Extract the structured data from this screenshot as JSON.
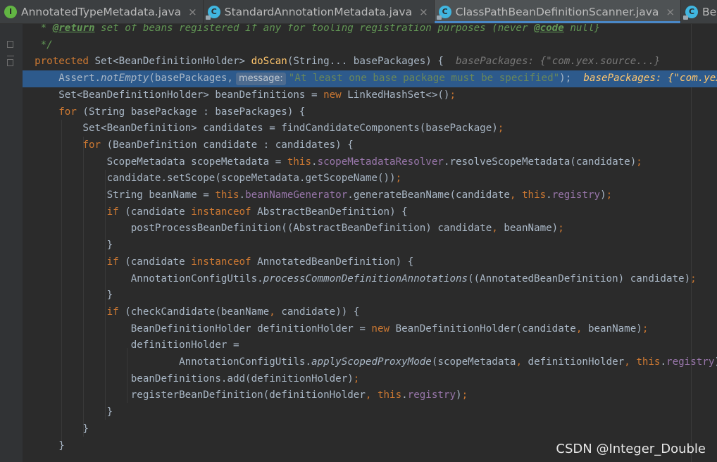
{
  "tabs": [
    {
      "label": "AnnotatedTypeMetadata.java",
      "icon": "interface-icon",
      "letter": "I"
    },
    {
      "label": "StandardAnnotationMetadata.java",
      "icon": "class-icon",
      "letter": "C"
    },
    {
      "label": "ClassPathBeanDefinitionScanner.java",
      "icon": "class-icon",
      "letter": "C",
      "active": true
    },
    {
      "label": "BeanDefini",
      "icon": "class-icon",
      "letter": "C"
    }
  ],
  "close_glyph": "×",
  "hint": {
    "message_label": "message:",
    "base_packages_header": "basePackages: {\"com.yex.source...}",
    "base_packages_line": "basePackages: {\"com.yex.sour"
  },
  "code": {
    "l0": "* ",
    "l0_tag": "@return",
    "l0_mid": " set of beans registered if any for tooling registration purposes (never ",
    "l0_code": "@code",
    "l0_end": " null}",
    "l1": "*/",
    "l2_kw": "protected",
    "l2_a": " Set<BeanDefinitionHolder> ",
    "l2_fn": "doScan",
    "l2_b": "(String... basePackages) {",
    "l3_a": "Assert.",
    "l3_fn": "notEmpty",
    "l3_b": "(basePackages,",
    "l3_str": "\"At least one base package must be specified\"",
    "l3_end": ");",
    "l4_a": "Set<BeanDefinitionHolder> beanDefinitions = ",
    "l4_kw": "new",
    "l4_b": " LinkedHashSet<>()",
    "l4_semi": ";",
    "l5_kw": "for",
    "l5_b": " (String basePackage : basePackages) {",
    "l6_a": "Set<BeanDefinition> candidates = findCandidateComponents(basePackage)",
    "l6_semi": ";",
    "l7_kw": "for",
    "l7_b": " (BeanDefinition candidate : candidates) {",
    "l8_a": "ScopeMetadata scopeMetadata = ",
    "l8_kw": "this",
    "l8_dot": ".",
    "l8_field": "scopeMetadataResolver",
    "l8_b": ".resolveScopeMetadata(candidate)",
    "l8_semi": ";",
    "l9_a": "candidate.setScope(scopeMetadata.getScopeName())",
    "l9_semi": ";",
    "l10_a": "String beanName = ",
    "l10_kw": "this",
    "l10_dot": ".",
    "l10_field": "beanNameGenerator",
    "l10_b": ".generateBeanName(candidate",
    "l10_comma": ", ",
    "l10_kw2": "this",
    "l10_dot2": ".",
    "l10_field2": "registry",
    "l10_c": ")",
    "l10_semi": ";",
    "l11_kw": "if",
    "l11_a": " (candidate ",
    "l11_kw2": "instanceof",
    "l11_b": " AbstractBeanDefinition) {",
    "l12_a": "postProcessBeanDefinition((AbstractBeanDefinition) candidate",
    "l12_comma": ", ",
    "l12_b": "beanName)",
    "l12_semi": ";",
    "l13": "}",
    "l14_kw": "if",
    "l14_a": " (candidate ",
    "l14_kw2": "instanceof",
    "l14_b": " AnnotatedBeanDefinition) {",
    "l15_a": "AnnotationConfigUtils.",
    "l15_fn": "processCommonDefinitionAnnotations",
    "l15_b": "((AnnotatedBeanDefinition) candidate)",
    "l15_semi": ";",
    "l16": "}",
    "l17_kw": "if",
    "l17_a": " (checkCandidate(beanName",
    "l17_comma": ", ",
    "l17_b": "candidate)) {",
    "l18_a": "BeanDefinitionHolder definitionHolder = ",
    "l18_kw": "new",
    "l18_b": " BeanDefinitionHolder(candidate",
    "l18_comma": ", ",
    "l18_c": "beanName)",
    "l18_semi": ";",
    "l19": "definitionHolder =",
    "l20_a": "AnnotationConfigUtils.",
    "l20_fn": "applyScopedProxyMode",
    "l20_b": "(scopeMetadata",
    "l20_comma": ", ",
    "l20_c": "definitionHolder",
    "l20_comma2": ", ",
    "l20_kw": "this",
    "l20_dot": ".",
    "l20_field": "registry",
    "l20_d": ")",
    "l20_semi": ";",
    "l21_a": "beanDefinitions.add(definitionHolder)",
    "l21_semi": ";",
    "l22_a": "registerBeanDefinition(definitionHolder",
    "l22_comma": ", ",
    "l22_kw": "this",
    "l22_dot": ".",
    "l22_field": "registry",
    "l22_b": ")",
    "l22_semi": ";",
    "l23": "}",
    "l24": "}",
    "l25": "}"
  },
  "watermark": "CSDN @Integer_Double"
}
